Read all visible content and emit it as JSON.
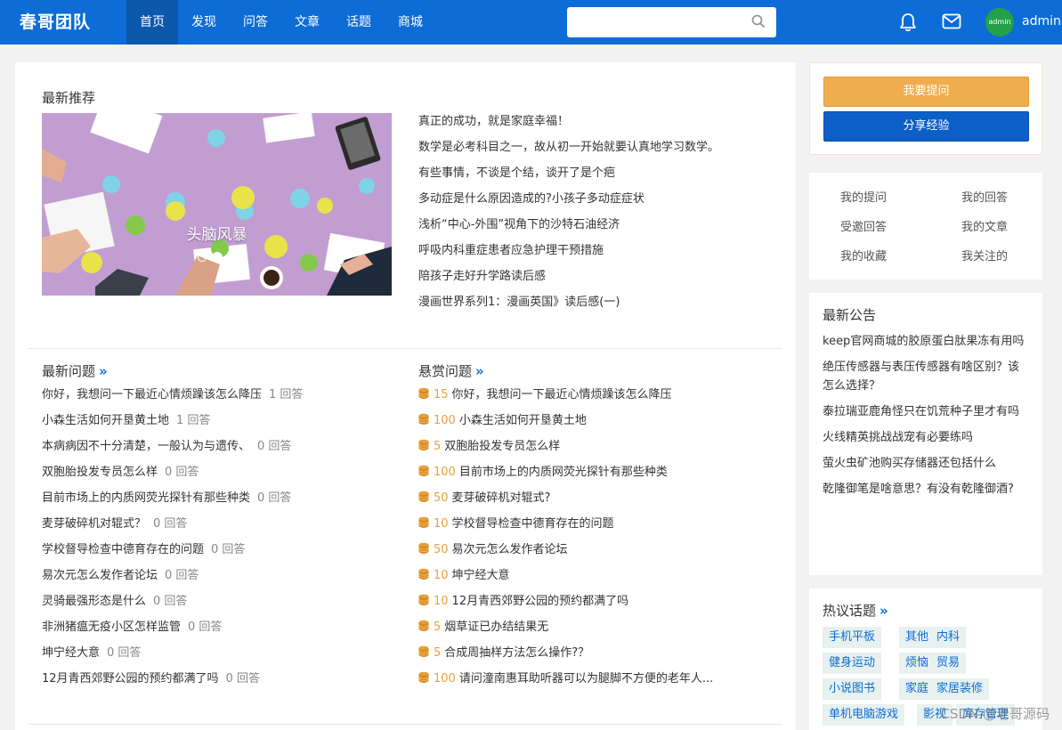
{
  "brand": "春哥团队",
  "nav": [
    "首页",
    "发现",
    "问答",
    "文章",
    "话题",
    "商城"
  ],
  "search": {
    "placeholder": ""
  },
  "user": {
    "avatar_text": "admin",
    "name": "admin"
  },
  "colors": {
    "primary": "#0d6cd6",
    "accent": "#f0ad4e",
    "reward": "#e8a03a"
  },
  "recommend": {
    "title": "最新推荐",
    "carousel_caption": "头脑风暴",
    "items": [
      "真正的成功，就是家庭幸福！",
      "数学是必考科目之一，故从初一开始就要认真地学习数学。",
      "有些事情，不谈是个结，谈开了是个疤",
      "多动症是什么原因造成的?小孩子多动症症状",
      "浅析“中心-外围”视角下的沙特石油经济",
      "呼吸内科重症患者应急护理干预措施",
      "陪孩子走好升学路读后感",
      "漫画世界系列1：漫画英国》读后感(一)"
    ]
  },
  "latest_questions": {
    "title": "最新问题",
    "more": "»",
    "items": [
      {
        "text": "你好，我想问一下最近心情烦躁该怎么降压",
        "count": "1 回答"
      },
      {
        "text": "小森生活如何开垦黄土地",
        "count": "1 回答"
      },
      {
        "text": "本病病因不十分清楚，一般认为与遗传、",
        "count": "0 回答"
      },
      {
        "text": "双胞胎投发专员怎么样",
        "count": "0 回答"
      },
      {
        "text": "目前市场上的内质网荧光探针有那些种类",
        "count": "0 回答"
      },
      {
        "text": "麦芽破碎机对辊式？",
        "count": "0 回答"
      },
      {
        "text": "学校督导检查中德育存在的问题",
        "count": "0 回答"
      },
      {
        "text": "易次元怎么发作者论坛",
        "count": "0 回答"
      },
      {
        "text": "灵骑最强形态是什么",
        "count": "0 回答"
      },
      {
        "text": "非洲猪瘟无疫小区怎样监管",
        "count": "0 回答"
      },
      {
        "text": "坤宁经大意",
        "count": "0 回答"
      },
      {
        "text": "12月青西郊野公园的预约都满了吗",
        "count": "0 回答"
      }
    ]
  },
  "reward_questions": {
    "title": "悬赏问题",
    "more": "»",
    "items": [
      {
        "reward": "15",
        "text": "你好，我想问一下最近心情烦躁该怎么降压"
      },
      {
        "reward": "100",
        "text": "小森生活如何开垦黄土地"
      },
      {
        "reward": "5",
        "text": "双胞胎投发专员怎么样"
      },
      {
        "reward": "100",
        "text": "目前市场上的内质网荧光探针有那些种类"
      },
      {
        "reward": "50",
        "text": "麦芽破碎机对辊式?"
      },
      {
        "reward": "10",
        "text": "学校督导检查中德育存在的问题"
      },
      {
        "reward": "50",
        "text": "易次元怎么发作者论坛"
      },
      {
        "reward": "10",
        "text": "坤宁经大意"
      },
      {
        "reward": "10",
        "text": "12月青西郊野公园的预约都满了吗"
      },
      {
        "reward": "5",
        "text": "烟草证已办结结果无"
      },
      {
        "reward": "5",
        "text": "合成周抽样方法怎么操作?？"
      },
      {
        "reward": "100",
        "text": "请问潼南惠耳助听器可以为腿脚不方便的老年人..."
      }
    ]
  },
  "sidebar": {
    "ask_button": "我要提问",
    "share_button": "分享经验",
    "links": [
      "我的提问",
      "我的回答",
      "受邀回答",
      "我的文章",
      "我的收藏",
      "我关注的"
    ],
    "notice_title": "最新公告",
    "notices": [
      "keep官网商城的胶原蛋白肽果冻有用吗",
      "绝压传感器与表压传感器有啥区别？该怎么选择？",
      "泰拉瑞亚鹿角怪只在饥荒种子里才有吗",
      "火线精英挑战战宠有必要练吗",
      "萤火虫矿池购买存储器还包括什么",
      "乾隆御笔是啥意思？有没有乾隆御酒?"
    ],
    "topics_title": "热议话题",
    "topics_more": "»",
    "topics": [
      "手机平板",
      "其他",
      "内科",
      "健身运动",
      "烦恼",
      "贸易",
      "小说图书",
      "家庭",
      "家居装修",
      "单机电脑游戏",
      "影视",
      "库存管理"
    ]
  },
  "watermark": "CSDN @老哥源码"
}
